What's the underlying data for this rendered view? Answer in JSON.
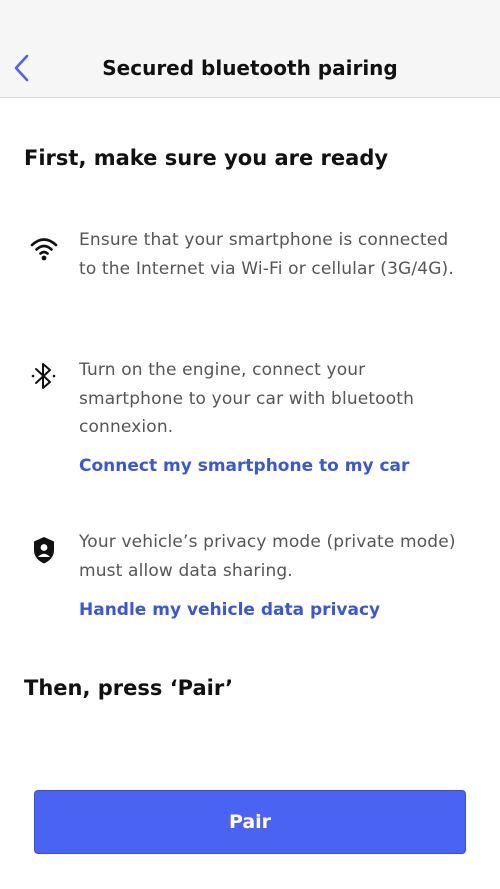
{
  "header": {
    "title": "Secured bluetooth pairing",
    "back_icon": "chevron-left-icon",
    "accent_color": "#4b63f3"
  },
  "ready_section": {
    "title": "First, make sure you are ready",
    "steps": [
      {
        "icon": "wifi-icon",
        "text": "Ensure that your smartphone is connected to the Internet via Wi-Fi or cellular (3G/4G)."
      },
      {
        "icon": "bluetooth-icon",
        "text": "Turn on the engine, connect your smartphone to your car with bluetooth connexion.",
        "link": "Connect my smartphone to my car"
      },
      {
        "icon": "privacy-shield-icon",
        "text": "Your vehicle’s privacy mode (private mode) must allow data sharing.",
        "link": "Handle my vehicle data privacy"
      }
    ]
  },
  "pair_section": {
    "title": "Then, press ‘Pair’",
    "button_label": "Pair"
  },
  "colors": {
    "link": "#3a57d6",
    "button": "#4b63f3",
    "body_text": "#555555"
  }
}
